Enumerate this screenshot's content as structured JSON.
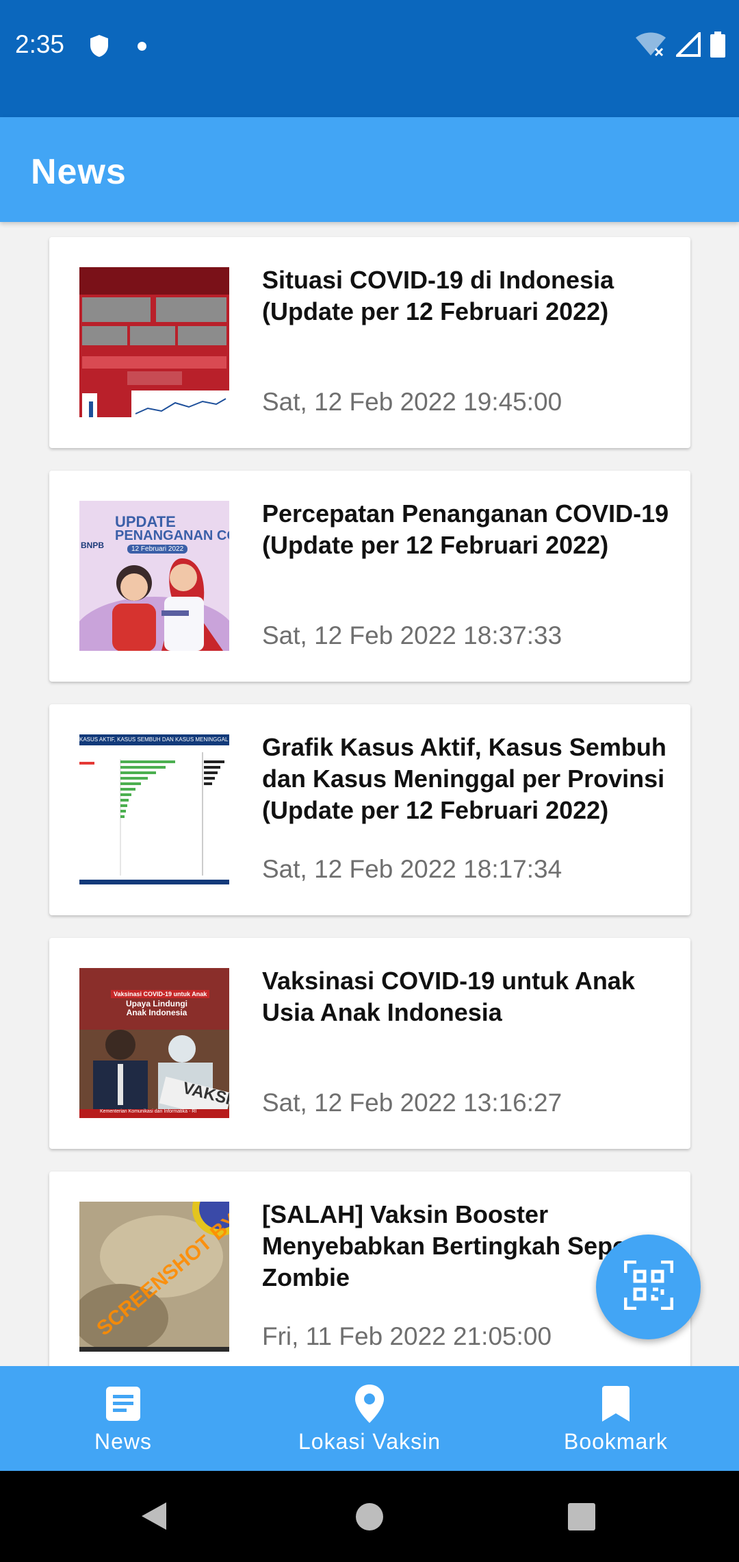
{
  "status_bar": {
    "time": "2:35",
    "icons": [
      "shield-icon",
      "notification-dot-icon",
      "wifi-off-icon",
      "signal-icon",
      "battery-icon"
    ]
  },
  "app_bar": {
    "title": "News"
  },
  "news": [
    {
      "title": "Situasi COVID-19 di Indonesia (Update per 12 Februari 2022)",
      "date": "Sat, 12 Feb 2022 19:45:00",
      "thumb": "covid-stats-infographic"
    },
    {
      "title": "Percepatan Penanganan COVID-19 (Update per 12 Februari 2022)",
      "date": "Sat, 12 Feb 2022 18:37:33",
      "thumb": "vaccination-illustration",
      "thumb_text": {
        "line1": "UPDATE",
        "line2": "PENANGANAN COV",
        "sub": "12 Februari 2022",
        "badge": "BNPB"
      }
    },
    {
      "title": "Grafik Kasus Aktif, Kasus Sembuh dan Kasus Meninggal per Provinsi (Update per 12 Februari 2022)",
      "date": "Sat, 12 Feb 2022 18:17:34",
      "thumb": "province-bar-chart",
      "thumb_text": {
        "header": "KASUS AKTIF, KASUS SEMBUH DAN KASUS MENINGGAL PER P"
      }
    },
    {
      "title": "Vaksinasi COVID-19 untuk Anak Usia Anak Indonesia",
      "date": "Sat, 12 Feb 2022 13:16:27",
      "thumb": "child-vaccination-photo",
      "thumb_text": {
        "banner": "Vaksinasi COVID-19 untuk Anak",
        "headline": "Upaya Lindungi Anak Indonesia",
        "sign": "VAKSIN",
        "footer": "Kementerian Komunikasi dan Informatika - RI"
      }
    },
    {
      "title": "[SALAH] Vaksin Booster Menyebabkan Bertingkah Seperti Zombie",
      "date": "Fri, 11 Feb 2022 21:05:00",
      "thumb": "hoax-screenshot",
      "thumb_text": {
        "watermark": "SCREENSHOT BY"
      }
    }
  ],
  "fab": {
    "icon": "qr-scan-icon"
  },
  "bottom_nav": [
    {
      "label": "News",
      "icon": "article-icon",
      "active": true
    },
    {
      "label": "Lokasi Vaksin",
      "icon": "location-pin-icon",
      "active": false
    },
    {
      "label": "Bookmark",
      "icon": "bookmark-icon",
      "active": false
    }
  ],
  "colors": {
    "status_bar": "#0b67bd",
    "primary": "#42a5f5",
    "date_text": "#6f6f6f"
  }
}
